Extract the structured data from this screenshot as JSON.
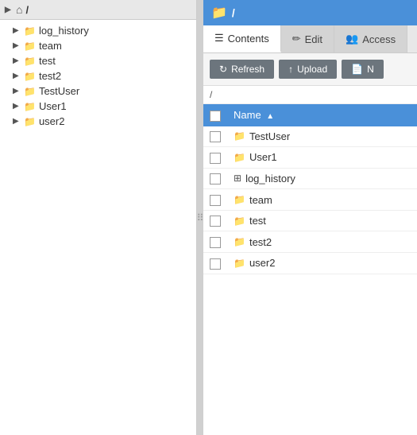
{
  "left_panel": {
    "header": {
      "arrow": "▶",
      "home_symbol": "⌂",
      "root_label": "/"
    },
    "tree_items": [
      {
        "id": "log_history",
        "label": "log_history",
        "icon": "folder",
        "indent": 1
      },
      {
        "id": "team",
        "label": "team",
        "icon": "folder",
        "indent": 1
      },
      {
        "id": "test",
        "label": "test",
        "icon": "folder",
        "indent": 1
      },
      {
        "id": "test2",
        "label": "test2",
        "icon": "folder",
        "indent": 1
      },
      {
        "id": "TestUser",
        "label": "TestUser",
        "icon": "folder",
        "indent": 1
      },
      {
        "id": "User1",
        "label": "User1",
        "icon": "folder",
        "indent": 1
      },
      {
        "id": "user2",
        "label": "user2",
        "icon": "folder",
        "indent": 1
      }
    ]
  },
  "right_panel": {
    "header": {
      "root_label": "/"
    },
    "tabs": [
      {
        "id": "contents",
        "label": "Contents",
        "icon": "☰",
        "active": true
      },
      {
        "id": "edit",
        "label": "Edit",
        "icon": "✏",
        "active": false
      },
      {
        "id": "access",
        "label": "Access",
        "icon": "👥",
        "active": false
      }
    ],
    "toolbar": {
      "refresh_label": "Refresh",
      "upload_label": "Upload",
      "new_label": "N"
    },
    "path_bar": "/",
    "table": {
      "columns": [
        {
          "id": "check",
          "label": ""
        },
        {
          "id": "name",
          "label": "Name",
          "sort": "asc"
        }
      ],
      "rows": [
        {
          "id": "TestUser",
          "name": "TestUser",
          "icon": "folder",
          "type": "folder"
        },
        {
          "id": "User1",
          "name": "User1",
          "icon": "folder",
          "type": "folder"
        },
        {
          "id": "log_history",
          "name": "log_history",
          "icon": "group",
          "type": "group"
        },
        {
          "id": "team",
          "name": "team",
          "icon": "folder",
          "type": "folder"
        },
        {
          "id": "test",
          "name": "test",
          "icon": "folder",
          "type": "folder"
        },
        {
          "id": "test2",
          "name": "test2",
          "icon": "folder",
          "type": "folder"
        },
        {
          "id": "user2",
          "name": "user2",
          "icon": "folder",
          "type": "folder"
        }
      ]
    }
  }
}
